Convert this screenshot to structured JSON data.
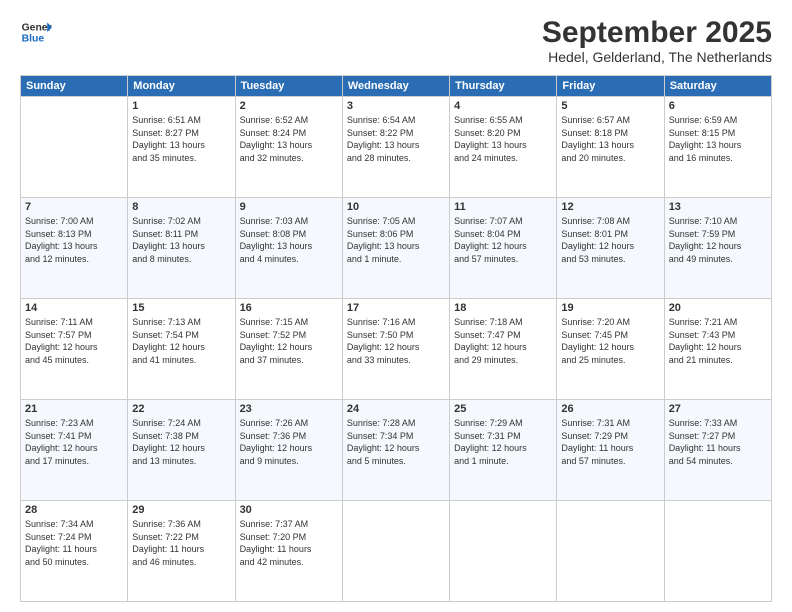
{
  "header": {
    "logo_line1": "General",
    "logo_line2": "Blue",
    "title": "September 2025",
    "subtitle": "Hedel, Gelderland, The Netherlands"
  },
  "calendar": {
    "headers": [
      "Sunday",
      "Monday",
      "Tuesday",
      "Wednesday",
      "Thursday",
      "Friday",
      "Saturday"
    ],
    "rows": [
      [
        {
          "num": "",
          "info": ""
        },
        {
          "num": "1",
          "info": "Sunrise: 6:51 AM\nSunset: 8:27 PM\nDaylight: 13 hours\nand 35 minutes."
        },
        {
          "num": "2",
          "info": "Sunrise: 6:52 AM\nSunset: 8:24 PM\nDaylight: 13 hours\nand 32 minutes."
        },
        {
          "num": "3",
          "info": "Sunrise: 6:54 AM\nSunset: 8:22 PM\nDaylight: 13 hours\nand 28 minutes."
        },
        {
          "num": "4",
          "info": "Sunrise: 6:55 AM\nSunset: 8:20 PM\nDaylight: 13 hours\nand 24 minutes."
        },
        {
          "num": "5",
          "info": "Sunrise: 6:57 AM\nSunset: 8:18 PM\nDaylight: 13 hours\nand 20 minutes."
        },
        {
          "num": "6",
          "info": "Sunrise: 6:59 AM\nSunset: 8:15 PM\nDaylight: 13 hours\nand 16 minutes."
        }
      ],
      [
        {
          "num": "7",
          "info": "Sunrise: 7:00 AM\nSunset: 8:13 PM\nDaylight: 13 hours\nand 12 minutes."
        },
        {
          "num": "8",
          "info": "Sunrise: 7:02 AM\nSunset: 8:11 PM\nDaylight: 13 hours\nand 8 minutes."
        },
        {
          "num": "9",
          "info": "Sunrise: 7:03 AM\nSunset: 8:08 PM\nDaylight: 13 hours\nand 4 minutes."
        },
        {
          "num": "10",
          "info": "Sunrise: 7:05 AM\nSunset: 8:06 PM\nDaylight: 13 hours\nand 1 minute."
        },
        {
          "num": "11",
          "info": "Sunrise: 7:07 AM\nSunset: 8:04 PM\nDaylight: 12 hours\nand 57 minutes."
        },
        {
          "num": "12",
          "info": "Sunrise: 7:08 AM\nSunset: 8:01 PM\nDaylight: 12 hours\nand 53 minutes."
        },
        {
          "num": "13",
          "info": "Sunrise: 7:10 AM\nSunset: 7:59 PM\nDaylight: 12 hours\nand 49 minutes."
        }
      ],
      [
        {
          "num": "14",
          "info": "Sunrise: 7:11 AM\nSunset: 7:57 PM\nDaylight: 12 hours\nand 45 minutes."
        },
        {
          "num": "15",
          "info": "Sunrise: 7:13 AM\nSunset: 7:54 PM\nDaylight: 12 hours\nand 41 minutes."
        },
        {
          "num": "16",
          "info": "Sunrise: 7:15 AM\nSunset: 7:52 PM\nDaylight: 12 hours\nand 37 minutes."
        },
        {
          "num": "17",
          "info": "Sunrise: 7:16 AM\nSunset: 7:50 PM\nDaylight: 12 hours\nand 33 minutes."
        },
        {
          "num": "18",
          "info": "Sunrise: 7:18 AM\nSunset: 7:47 PM\nDaylight: 12 hours\nand 29 minutes."
        },
        {
          "num": "19",
          "info": "Sunrise: 7:20 AM\nSunset: 7:45 PM\nDaylight: 12 hours\nand 25 minutes."
        },
        {
          "num": "20",
          "info": "Sunrise: 7:21 AM\nSunset: 7:43 PM\nDaylight: 12 hours\nand 21 minutes."
        }
      ],
      [
        {
          "num": "21",
          "info": "Sunrise: 7:23 AM\nSunset: 7:41 PM\nDaylight: 12 hours\nand 17 minutes."
        },
        {
          "num": "22",
          "info": "Sunrise: 7:24 AM\nSunset: 7:38 PM\nDaylight: 12 hours\nand 13 minutes."
        },
        {
          "num": "23",
          "info": "Sunrise: 7:26 AM\nSunset: 7:36 PM\nDaylight: 12 hours\nand 9 minutes."
        },
        {
          "num": "24",
          "info": "Sunrise: 7:28 AM\nSunset: 7:34 PM\nDaylight: 12 hours\nand 5 minutes."
        },
        {
          "num": "25",
          "info": "Sunrise: 7:29 AM\nSunset: 7:31 PM\nDaylight: 12 hours\nand 1 minute."
        },
        {
          "num": "26",
          "info": "Sunrise: 7:31 AM\nSunset: 7:29 PM\nDaylight: 11 hours\nand 57 minutes."
        },
        {
          "num": "27",
          "info": "Sunrise: 7:33 AM\nSunset: 7:27 PM\nDaylight: 11 hours\nand 54 minutes."
        }
      ],
      [
        {
          "num": "28",
          "info": "Sunrise: 7:34 AM\nSunset: 7:24 PM\nDaylight: 11 hours\nand 50 minutes."
        },
        {
          "num": "29",
          "info": "Sunrise: 7:36 AM\nSunset: 7:22 PM\nDaylight: 11 hours\nand 46 minutes."
        },
        {
          "num": "30",
          "info": "Sunrise: 7:37 AM\nSunset: 7:20 PM\nDaylight: 11 hours\nand 42 minutes."
        },
        {
          "num": "",
          "info": ""
        },
        {
          "num": "",
          "info": ""
        },
        {
          "num": "",
          "info": ""
        },
        {
          "num": "",
          "info": ""
        }
      ]
    ]
  }
}
